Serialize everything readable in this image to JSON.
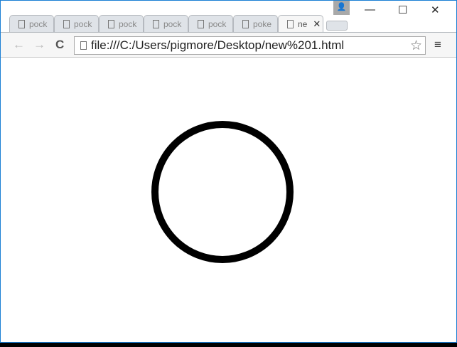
{
  "tabs": [
    {
      "label": "pock"
    },
    {
      "label": "pock"
    },
    {
      "label": "pock"
    },
    {
      "label": "pock"
    },
    {
      "label": "pock"
    },
    {
      "label": "poke"
    },
    {
      "label": "ne",
      "active": true
    }
  ],
  "window": {
    "minimize": "—",
    "maximize": "☐",
    "close": "✕",
    "user": "👤"
  },
  "toolbar": {
    "back": "←",
    "forward": "→",
    "reload": "C",
    "url": "file:///C:/Users/pigmore/Desktop/new%201.html",
    "star": "☆",
    "menu": "≡"
  },
  "tab_close": "✕"
}
